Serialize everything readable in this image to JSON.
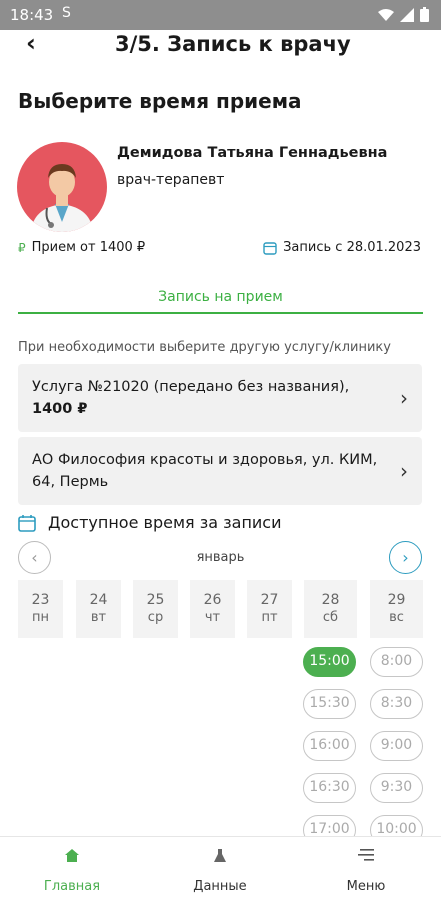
{
  "status_bar": {
    "time": "18:43",
    "sim_glyph": "S"
  },
  "header": {
    "title": "3/5. Запись к врачу"
  },
  "page": {
    "heading": "Выберите время приема"
  },
  "doctor": {
    "name": "Демидова Татьяна Геннадьевна",
    "role": "врач-терапевт"
  },
  "info": {
    "price": "Прием от 1400 ₽",
    "date": "Запись с 28.01.2023"
  },
  "tab": {
    "label": "Запись на прием"
  },
  "hint": "При необходимости выберите другую услугу/клинику",
  "service": {
    "line1": "Услуга №21020 (передано без названия),",
    "line2": "1400 ₽"
  },
  "clinic": {
    "line1": "АО Философия красоты и здоровья, ул. КИМ,",
    "line2": "64, Пермь"
  },
  "schedule": {
    "title": "Доступное время за записи",
    "month": "январь",
    "days": [
      {
        "num": "23",
        "dow": "пн"
      },
      {
        "num": "24",
        "dow": "вт"
      },
      {
        "num": "25",
        "dow": "ср"
      },
      {
        "num": "26",
        "dow": "чт"
      },
      {
        "num": "27",
        "dow": "пт"
      },
      {
        "num": "28",
        "dow": "сб"
      },
      {
        "num": "29",
        "dow": "вс"
      }
    ],
    "slots_left": [
      "15:00",
      "15:30",
      "16:00",
      "16:30",
      "17:00"
    ],
    "slots_right": [
      "8:00",
      "8:30",
      "9:00",
      "9:30",
      "10:00"
    ],
    "selected_slot": "15:00"
  },
  "bottom_nav": {
    "home": "Главная",
    "data": "Данные",
    "menu": "Меню"
  },
  "colors": {
    "accent_green": "#4caf50",
    "avatar_red": "#e5565f",
    "nav_blue": "#2d9cbf",
    "status_bar": "#8e8e8e"
  }
}
